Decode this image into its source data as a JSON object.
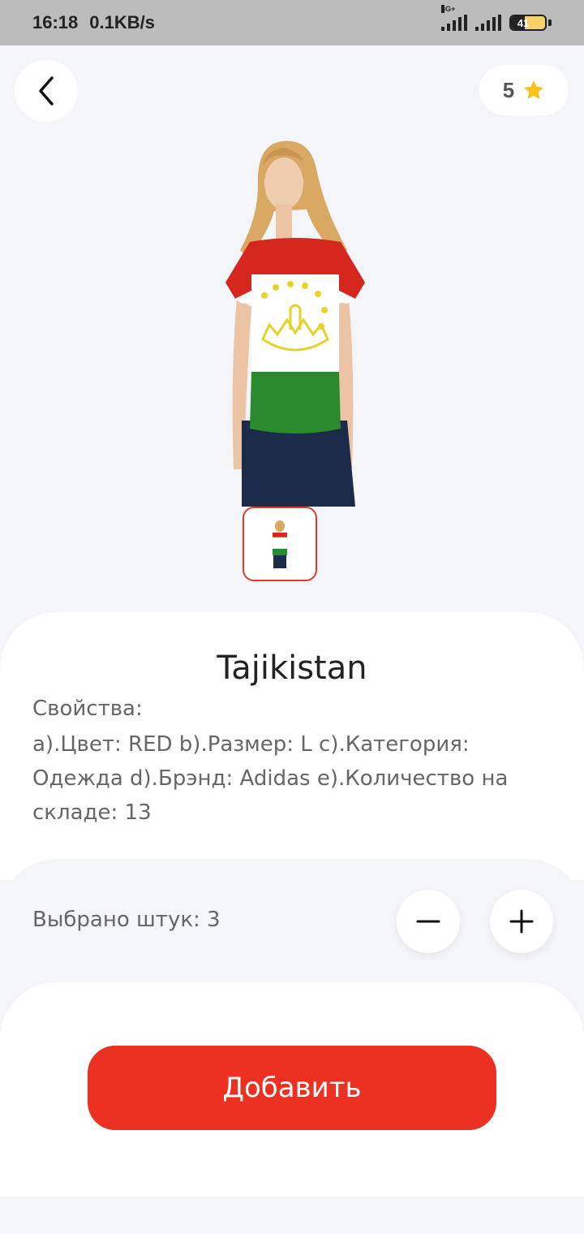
{
  "status_bar": {
    "time": "16:18",
    "speed": "0.1KB/s",
    "network": "4G+",
    "battery": "41"
  },
  "header": {
    "rating": "5"
  },
  "product": {
    "title": "Tajikistan",
    "props_heading": "Свойства:",
    "props_text": "a).Цвет: RED b).Размер: L c).Категория: Одежда d).Брэнд: Adidas e).Количество на складе: 13"
  },
  "quantity": {
    "label": "Выбрано штук: 3"
  },
  "actions": {
    "add_label": "Добавить"
  },
  "colors": {
    "accent": "#ec3022",
    "star": "#f7c21b",
    "background": "#f4f5f9"
  }
}
